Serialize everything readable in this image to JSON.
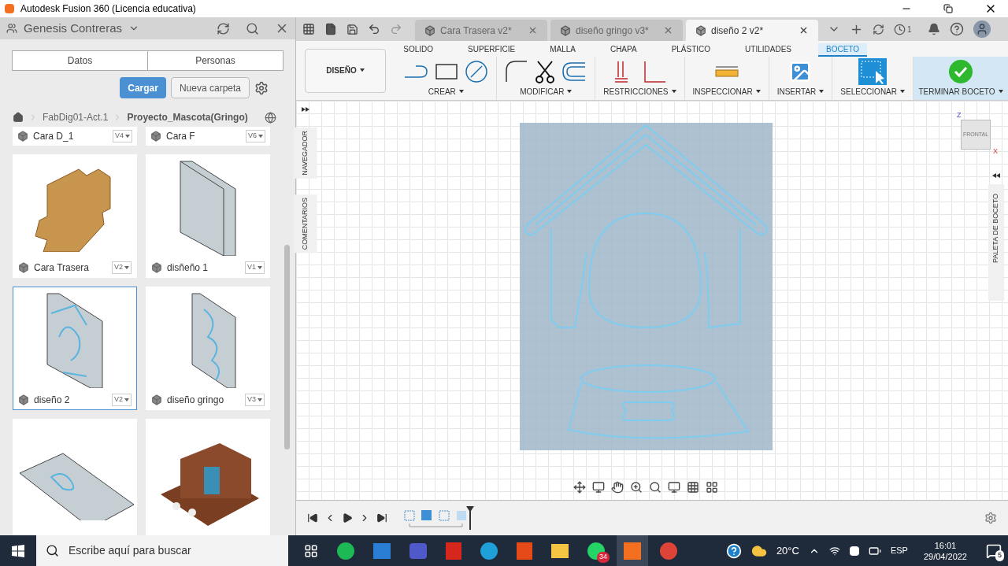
{
  "window": {
    "title": "Autodesk Fusion 360 (Licencia educativa)"
  },
  "data_panel": {
    "user": "Genesis Contreras",
    "tabs": [
      {
        "label": "Datos",
        "selected": false
      },
      {
        "label": "Personas",
        "selected": false
      }
    ],
    "upload_button": "Cargar",
    "new_folder_button": "Nueva carpeta",
    "breadcrumb": [
      "FabDig01-Act.1",
      "Proyecto_Mascota(Gringo)"
    ],
    "top_files": [
      {
        "name": "Cara D_1",
        "version": "V4"
      },
      {
        "name": "Cara F",
        "version": "V6"
      }
    ],
    "files": [
      {
        "name": "Cara Trasera",
        "version": "V2",
        "kind": "puzzle",
        "selected": false
      },
      {
        "name": "disñeño 1",
        "version": "V1",
        "kind": "panel",
        "selected": false
      },
      {
        "name": "diseño 2",
        "version": "V2",
        "kind": "engraved",
        "selected": true
      },
      {
        "name": "diseño gringo",
        "version": "V3",
        "kind": "script",
        "selected": false
      }
    ],
    "partial_files": [
      {
        "kind": "board"
      },
      {
        "kind": "house"
      }
    ]
  },
  "document_tabs": [
    {
      "label": "Cara Trasera v2*",
      "selected": false
    },
    {
      "label": "diseño gringo v3*",
      "selected": false
    },
    {
      "label": "diseño 2 v2*",
      "selected": true
    }
  ],
  "job_count": "1",
  "toolbar": {
    "workspace": "DISEÑO",
    "tabs": [
      {
        "label": "SOLIDO",
        "selected": false
      },
      {
        "label": "SUPERFICIE",
        "selected": false
      },
      {
        "label": "MALLA",
        "selected": false
      },
      {
        "label": "CHAPA",
        "selected": false
      },
      {
        "label": "PLÁSTICO",
        "selected": false
      },
      {
        "label": "UTILIDADES",
        "selected": false
      },
      {
        "label": "BOCETO",
        "selected": true
      }
    ],
    "groups": [
      {
        "label": "CREAR",
        "kind": "create"
      },
      {
        "label": "MODIFICAR",
        "kind": "modify"
      },
      {
        "label": "RESTRICCIONES",
        "kind": "constraints"
      },
      {
        "label": "INSPECCIONAR",
        "kind": "inspect"
      },
      {
        "label": "INSERTAR",
        "kind": "insert"
      },
      {
        "label": "SELECCIONAR",
        "kind": "select"
      },
      {
        "label": "TERMINAR BOCETO",
        "kind": "finish"
      }
    ]
  },
  "canvas": {
    "left_panels": [
      "NAVEGADOR",
      "COMENTARIOS"
    ],
    "right_panel": "PALETA DE BOCETO",
    "view_cube": "FRONTAL",
    "axis_z": "Z",
    "axis_x": "X"
  },
  "taskbar": {
    "search_placeholder": "Escribe aquí para buscar",
    "whatsapp_badge": "34",
    "temperature": "20°C",
    "language": "ESP",
    "time": "16:01",
    "date": "29/04/2022",
    "notifications": "5"
  }
}
